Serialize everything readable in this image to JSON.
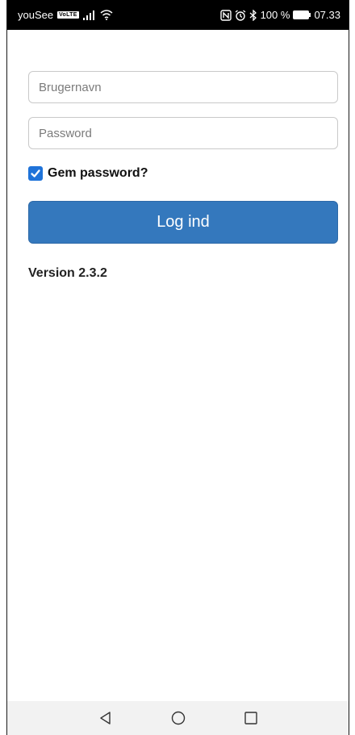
{
  "status_bar": {
    "carrier": "youSee",
    "volte_badge": "VoLTE",
    "battery_percent": "100 %",
    "time": "07.33",
    "icons": [
      "signal-icon",
      "wifi-icon",
      "nfc-icon",
      "alarm-icon",
      "bluetooth-icon",
      "battery-icon"
    ]
  },
  "login_form": {
    "username_placeholder": "Brugernavn",
    "password_placeholder": "Password",
    "remember_label": "Gem password?",
    "remember_checked": true,
    "login_button_label": "Log ind"
  },
  "version_text": "Version 2.3.2",
  "nav_bar": {
    "icons": [
      "back-icon",
      "home-icon",
      "recents-icon"
    ]
  },
  "colors": {
    "accent": "#3478bd",
    "checkbox": "#1f73d9",
    "status_bar_bg": "#000000",
    "nav_bar_bg": "#f2f2f2"
  }
}
